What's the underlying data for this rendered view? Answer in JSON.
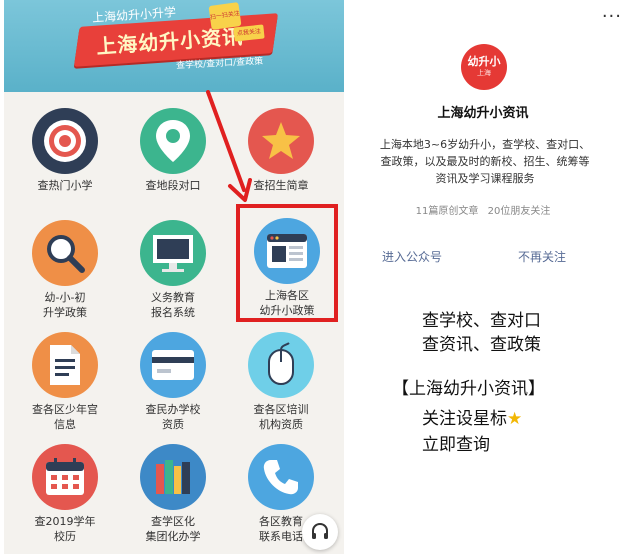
{
  "banner": {
    "subtitle": "上海幼升小升学",
    "title": "上海幼升小资讯",
    "tagline": "查学校/查对口/查政策",
    "sticker": "扫一扫关注",
    "sticker2": "点我关注"
  },
  "grid": [
    {
      "id": "hot-school",
      "label": "查热门小学",
      "icon": "target-icon",
      "color": "#2f3e56"
    },
    {
      "id": "district",
      "label": "查地段对口",
      "icon": "location-pin-icon",
      "color": "#3cb58e"
    },
    {
      "id": "enrollment",
      "label": "查招生简章",
      "icon": "star-icon",
      "color": "#e4574f"
    },
    {
      "id": "policy",
      "label": "幼-小-初\n升学政策",
      "icon": "magnifier-icon",
      "color": "#ef8f47"
    },
    {
      "id": "compulsory",
      "label": "义务教育\n报名系统",
      "icon": "monitor-icon",
      "color": "#3cb58e"
    },
    {
      "id": "districts",
      "label": "上海各区\n幼升小政策",
      "icon": "browser-window-icon",
      "color": "#4da6e0"
    },
    {
      "id": "youth-palace",
      "label": "查各区少年宫\n信息",
      "icon": "document-icon",
      "color": "#ef8f47"
    },
    {
      "id": "private",
      "label": "查民办学校\n资质",
      "icon": "card-icon",
      "color": "#4da6e0"
    },
    {
      "id": "training",
      "label": "查各区培训\n机构资质",
      "icon": "mouse-icon",
      "color": "#6fcfe8"
    },
    {
      "id": "calendar",
      "label": "查2019学年\n校历",
      "icon": "calendar-icon",
      "color": "#e4574f"
    },
    {
      "id": "cluster",
      "label": "查学区化\n集团化办学",
      "icon": "books-icon",
      "color": "#3d89c7"
    },
    {
      "id": "contact",
      "label": "各区教育\n联系电话",
      "icon": "phone-icon",
      "color": "#4da6e0"
    }
  ],
  "profile": {
    "more_label": "···",
    "logo_main": "幼升小",
    "logo_sub": "上海",
    "name": "上海幼升小资讯",
    "description": "上海本地3~6岁幼升小，查学校、查对口、查政策，以及最及时的新校、招生、统筹等资讯及学习课程服务",
    "articles": "11篇原创文章",
    "friends": "20位朋友关注",
    "enter_label": "进入公众号",
    "unfollow_label": "不再关注"
  },
  "promo": {
    "line1": "查学校、查对口",
    "line2": "查资讯、查政策",
    "line3": "【上海幼升小资讯】",
    "line4": "关注设星标",
    "line4_star": "★",
    "line5": "立即查询"
  },
  "colors": {
    "highlight": "#e02020",
    "link": "#576b95",
    "logo": "#e53935"
  }
}
